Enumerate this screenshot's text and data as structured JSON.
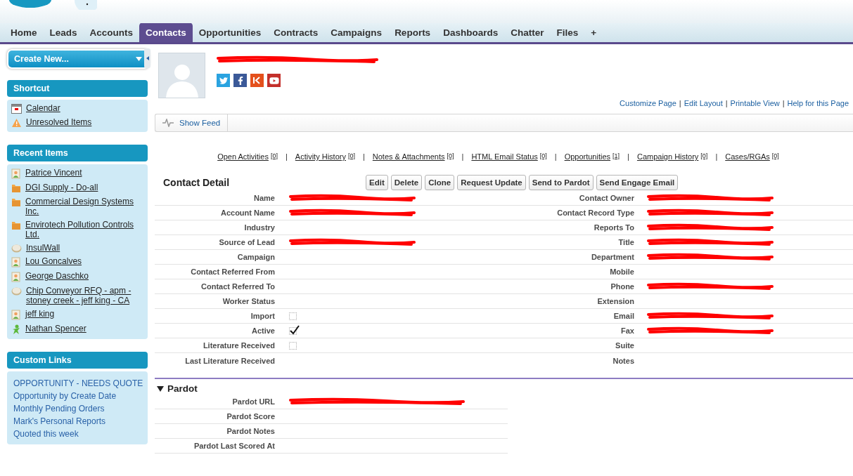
{
  "tabs": [
    {
      "label": "Home",
      "selected": false
    },
    {
      "label": "Leads",
      "selected": false
    },
    {
      "label": "Accounts",
      "selected": false
    },
    {
      "label": "Contacts",
      "selected": true
    },
    {
      "label": "Opportunities",
      "selected": false
    },
    {
      "label": "Contracts",
      "selected": false
    },
    {
      "label": "Campaigns",
      "selected": false
    },
    {
      "label": "Reports",
      "selected": false
    },
    {
      "label": "Dashboards",
      "selected": false
    },
    {
      "label": "Chatter",
      "selected": false
    },
    {
      "label": "Files",
      "selected": false
    },
    {
      "label": "+",
      "selected": false
    }
  ],
  "sidebar": {
    "create_button": "Create New...",
    "shortcut": {
      "title": "Shortcut",
      "items": [
        {
          "label": "Calendar",
          "kind": "calendar"
        },
        {
          "label": "Unresolved Items",
          "kind": "warning"
        }
      ]
    },
    "recent": {
      "title": "Recent Items",
      "items": [
        {
          "label": "Patrice Vincent",
          "kind": "contact"
        },
        {
          "label": "DGI Supply - Do-all",
          "kind": "account"
        },
        {
          "label": "Commercial Design Systems Inc.",
          "kind": "account"
        },
        {
          "label": "Envirotech Pollution Controls Ltd.",
          "kind": "account"
        },
        {
          "label": "InsulWall",
          "kind": "opportunity"
        },
        {
          "label": "Lou Goncalves",
          "kind": "contact"
        },
        {
          "label": "George Daschko",
          "kind": "contact"
        },
        {
          "label": "Chip Conveyor RFQ - apm - stoney creek - jeff king - CA",
          "kind": "opportunity"
        },
        {
          "label": "jeff king",
          "kind": "contact"
        },
        {
          "label": "Nathan Spencer",
          "kind": "user"
        }
      ]
    },
    "custom_links": {
      "title": "Custom Links",
      "items": [
        "OPPORTUNITY - NEEDS QUOTE",
        "Opportunity by Create Date",
        "Monthly Pending Orders",
        "Mark's Personal Reports",
        "Quoted this week"
      ]
    }
  },
  "record": {
    "title_redacted": true,
    "link_separator": "|",
    "page_links": [
      "Customize Page",
      "Edit Layout",
      "Printable View",
      "Help for this Page"
    ],
    "show_feed": "Show Feed",
    "related_links": [
      {
        "label": "Open Activities",
        "count": "[0]"
      },
      {
        "label": "Activity History",
        "count": "[0]"
      },
      {
        "label": "Notes & Attachments",
        "count": "[0]"
      },
      {
        "label": "HTML Email Status",
        "count": "[0]"
      },
      {
        "label": "Opportunities",
        "count": "[1]"
      },
      {
        "label": "Campaign History",
        "count": "[0]"
      },
      {
        "label": "Cases/RGAs",
        "count": "[0]"
      }
    ],
    "detail_title": "Contact Detail",
    "buttons": [
      "Edit",
      "Delete",
      "Clone",
      "Request Update",
      "Send to Pardot",
      "Send Engage Email"
    ],
    "rows": [
      {
        "left": {
          "label": "Name",
          "kind": "text",
          "redacted": true
        },
        "right": {
          "label": "Contact Owner",
          "kind": "text",
          "redacted": true
        }
      },
      {
        "left": {
          "label": "Account Name",
          "kind": "text",
          "redacted": true
        },
        "right": {
          "label": "Contact Record Type",
          "kind": "text",
          "redacted": true
        }
      },
      {
        "left": {
          "label": "Industry",
          "kind": "text",
          "redacted": false
        },
        "right": {
          "label": "Reports To",
          "kind": "text",
          "redacted": true
        }
      },
      {
        "left": {
          "label": "Source of Lead",
          "kind": "text",
          "redacted": true
        },
        "right": {
          "label": "Title",
          "kind": "text",
          "redacted": true
        }
      },
      {
        "left": {
          "label": "Campaign",
          "kind": "text",
          "redacted": false
        },
        "right": {
          "label": "Department",
          "kind": "text",
          "redacted": true
        }
      },
      {
        "left": {
          "label": "Contact Referred From",
          "kind": "text",
          "redacted": false
        },
        "right": {
          "label": "Mobile",
          "kind": "text",
          "redacted": false
        }
      },
      {
        "left": {
          "label": "Contact Referred To",
          "kind": "text",
          "redacted": false
        },
        "right": {
          "label": "Phone",
          "kind": "text",
          "redacted": true
        }
      },
      {
        "left": {
          "label": "Worker Status",
          "kind": "text",
          "redacted": false
        },
        "right": {
          "label": "Extension",
          "kind": "text",
          "redacted": false
        }
      },
      {
        "left": {
          "label": "Import",
          "kind": "checkbox",
          "checked": false
        },
        "right": {
          "label": "Email",
          "kind": "text",
          "redacted": true
        }
      },
      {
        "left": {
          "label": "Active",
          "kind": "checkbox",
          "checked": true
        },
        "right": {
          "label": "Fax",
          "kind": "text",
          "redacted": true
        }
      },
      {
        "left": {
          "label": "Literature Received",
          "kind": "checkbox",
          "checked": false
        },
        "right": {
          "label": "Suite",
          "kind": "text",
          "redacted": false
        }
      },
      {
        "left": {
          "label": "Last Literature Received",
          "kind": "text",
          "redacted": false
        },
        "right": {
          "label": "Notes",
          "kind": "text",
          "redacted": false
        }
      }
    ],
    "pardot": {
      "title": "Pardot",
      "expanded": true,
      "rows": [
        {
          "label": "Pardot URL",
          "redacted": true
        },
        {
          "label": "Pardot Score",
          "redacted": false
        },
        {
          "label": "Pardot Notes",
          "redacted": false
        },
        {
          "label": "Pardot Last Scored At",
          "redacted": false
        }
      ]
    }
  }
}
